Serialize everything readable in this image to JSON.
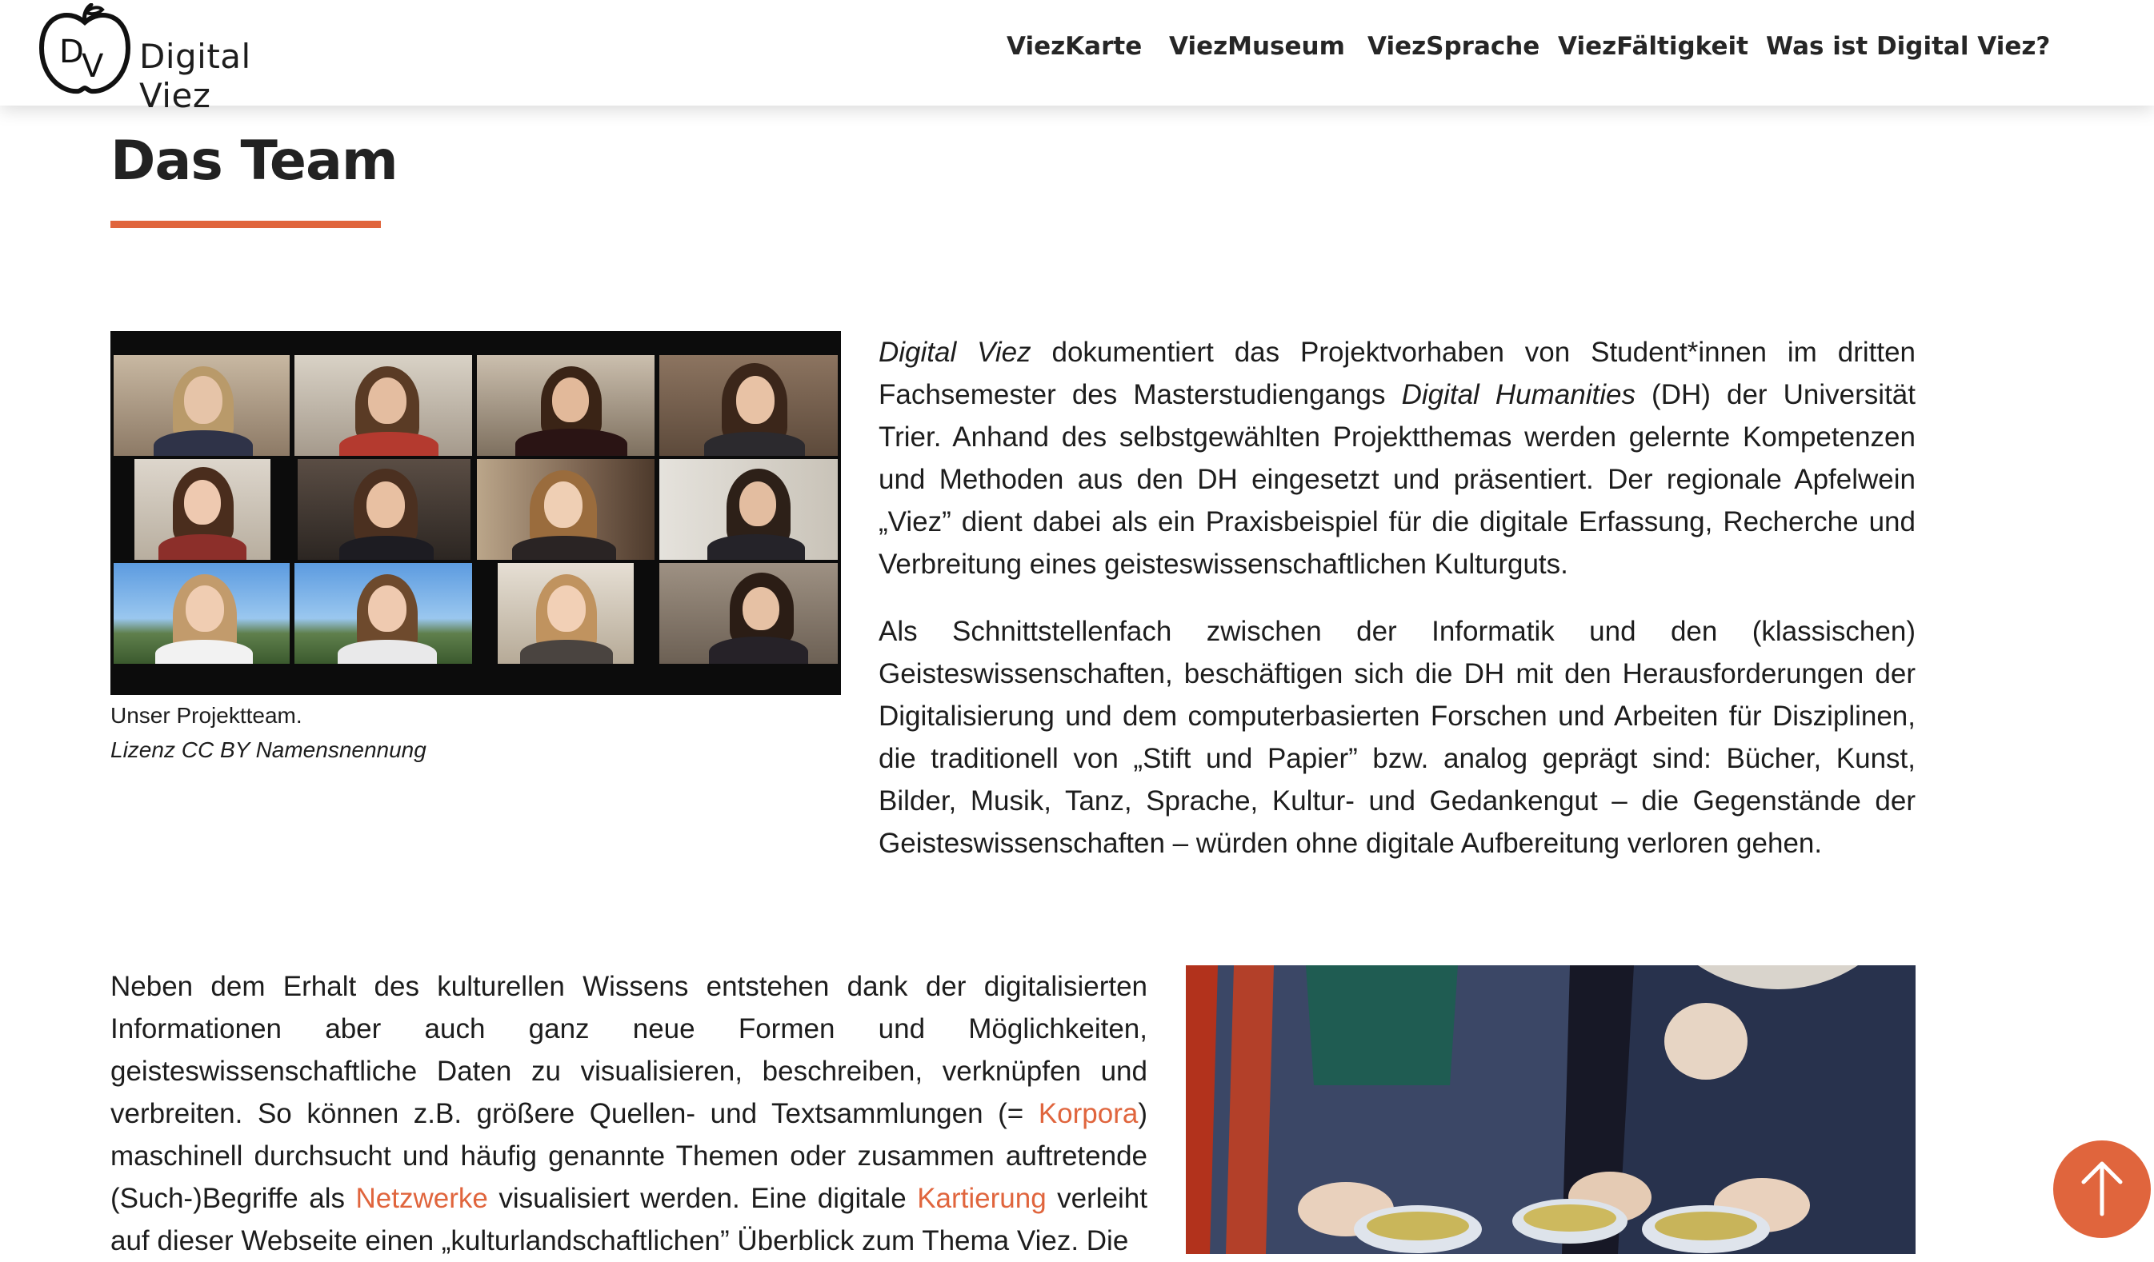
{
  "header": {
    "logo_text": "Digital Viez",
    "nav": [
      {
        "label": "ViezKarte"
      },
      {
        "label": "ViezMuseum"
      },
      {
        "label": "ViezSprache"
      },
      {
        "label": "ViezFältigkeit"
      },
      {
        "label": "Was ist Digital Viez?"
      }
    ]
  },
  "page": {
    "title": "Das Team"
  },
  "team_figure": {
    "caption": "Unser Projektteam.",
    "license": "Lizenz CC BY Namensnennung"
  },
  "intro": {
    "p1": {
      "part1": "Digital Viez",
      "part2": " dokumentiert das Projektvorhaben von Student*innen im dritten Fachsemester des Masterstudiengangs ",
      "part3": "Digital Humanities",
      "part4": " (DH) der Universität Trier. Anhand des selbstgewählten Projektthemas werden gelernte Kompetenzen und Methoden aus den DH eingesetzt und präsentiert. Der regionale Apfelwein „Viez” dient dabei als ein Praxisbeispiel für die digitale Erfassung, Recherche und Verbreitung eines geisteswissenschaftlichen Kulturguts."
    },
    "p2": "Als Schnittstellenfach zwischen der Informatik und den (klassischen) Geisteswissenschaften, beschäftigen sich die DH mit den Herausforderungen der Digitalisierung und dem computerbasierten Forschen und Arbeiten für Disziplinen, die traditionell von „Stift und Papier” bzw. analog geprägt sind: Bücher, Kunst, Bilder, Musik, Tanz, Sprache, Kultur- und Gedankengut – die Gegenstände der Geisteswissenschaften – würden ohne digitale Aufbereitung verloren gehen."
  },
  "body": {
    "p3": {
      "t1": "Neben dem Erhalt des kulturellen Wissens entstehen dank der digitalisierten Informationen aber auch ganz neue Formen und Möglichkeiten, geisteswissenschaftliche Daten zu visualisieren, beschreiben, verknüpfen und verbreiten. So können z.B. größere Quellen- und Textsammlungen (= ",
      "link1": "Korpora",
      "t2": ") maschinell durchsucht und häufig genannte Themen oder zusammen auftretende (Such-)Begriffe als ",
      "link2": "Netzwerke",
      "t3": " visualisiert werden. Eine digitale ",
      "link3": "Kartierung",
      "t4": " verleiht auf dieser Webseite einen „kulturlandschaftlichen” Überblick zum Thema Viez. Die"
    }
  },
  "colors": {
    "accent": "#e0653d",
    "text": "#1d1d1d",
    "header_bg": "#ffffff"
  },
  "icons": {
    "logo": "apple-dv-logo",
    "back_to_top": "arrow-up-icon"
  }
}
